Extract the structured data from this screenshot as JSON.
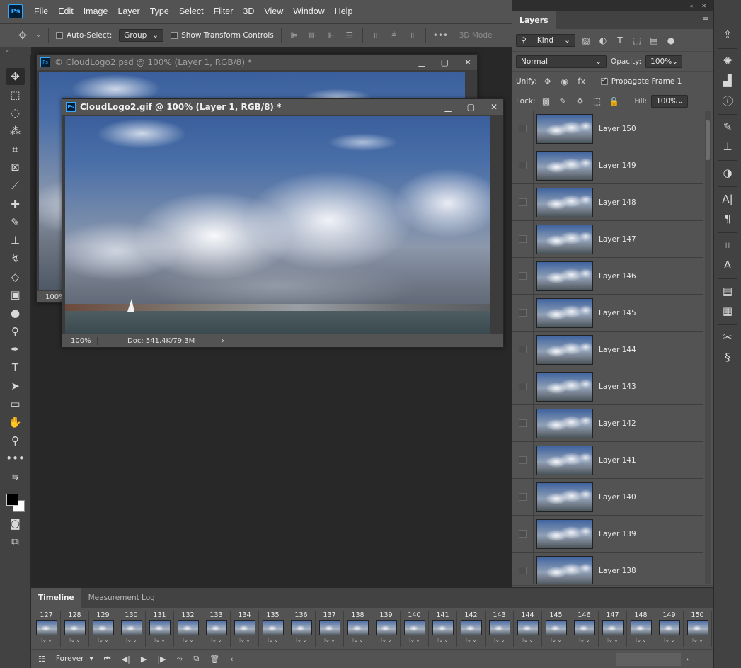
{
  "menu": {
    "logo": "Ps",
    "items": [
      "File",
      "Edit",
      "Image",
      "Layer",
      "Type",
      "Select",
      "Filter",
      "3D",
      "View",
      "Window",
      "Help"
    ]
  },
  "options": {
    "auto_select_label": "Auto-Select:",
    "auto_select_value": "Group",
    "show_transform_label": "Show Transform Controls",
    "mode3d": "3D Mode"
  },
  "doc_back": {
    "title": "© CloudLogo2.psd @ 100% (Layer 1, RGB/8) *",
    "zoom": "100%"
  },
  "doc_front": {
    "title": "CloudLogo2.gif @ 100% (Layer 1, RGB/8) *",
    "zoom": "100%",
    "doc_info": "Doc: 541.4K/79.3M"
  },
  "layers": {
    "tab": "Layers",
    "filter": "Kind",
    "blend_mode": "Normal",
    "opacity_label": "Opacity:",
    "opacity": "100%",
    "unify_label": "Unify:",
    "propagate_label": "Propagate Frame 1",
    "lock_label": "Lock:",
    "fill_label": "Fill:",
    "fill": "100%",
    "items": [
      "Layer 150",
      "Layer 149",
      "Layer 148",
      "Layer 147",
      "Layer 146",
      "Layer 145",
      "Layer 144",
      "Layer 143",
      "Layer 142",
      "Layer 141",
      "Layer 140",
      "Layer 139",
      "Layer 138"
    ]
  },
  "timeline": {
    "tabs": [
      "Timeline",
      "Measurement Log"
    ],
    "frames": [
      "127",
      "128",
      "129",
      "130",
      "131",
      "132",
      "133",
      "134",
      "135",
      "136",
      "137",
      "138",
      "139",
      "140",
      "141",
      "142",
      "143",
      "144",
      "145",
      "146",
      "147",
      "148",
      "149",
      "150"
    ],
    "loop": "Forever"
  }
}
